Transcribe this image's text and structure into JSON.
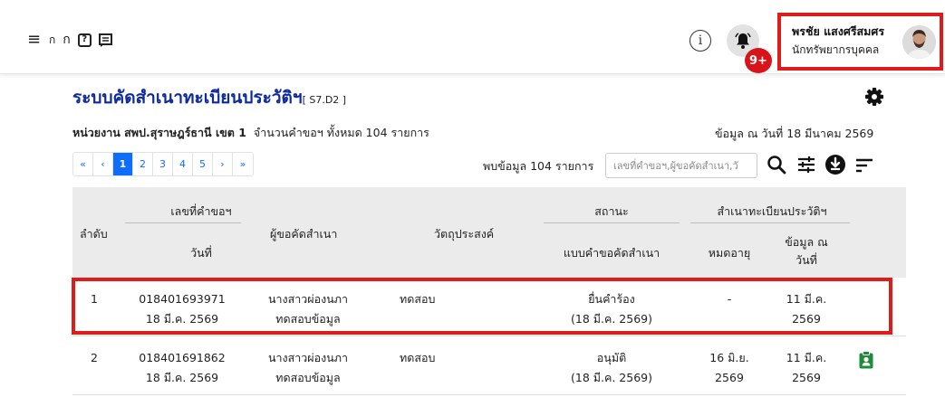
{
  "toolbar": {
    "menu_icon": "hamburger-icon",
    "font_small": "ก",
    "font_large": "ก",
    "help_label": "?",
    "info_label": "i",
    "notification_badge": "9+"
  },
  "user": {
    "name": "พรชัย แสงศรีสมศร",
    "role": "นักทรัพยากรบุคคล"
  },
  "page": {
    "title": "ระบบคัดสำเนาทะเบียนประวัติฯ",
    "code": "[ S7.D2 ]",
    "org_label": "หน่วยงาน สพป.สุราษฎร์ธานี เขต 1",
    "request_count": "จำนวนคำขอฯ ทั้งหมด 104 รายการ",
    "data_date": "ข้อมูล ณ วันที่ 18 มีนาคม 2569",
    "found_text": "พบข้อมูล 104 รายการ",
    "search_placeholder": "เลขที่คำขอฯ,ผู้ขอคัดสำเนา,วั"
  },
  "pagination": [
    "«",
    "‹",
    "1",
    "2",
    "3",
    "4",
    "5",
    "›",
    "»"
  ],
  "table": {
    "headers": {
      "no": "ลำดับ",
      "request_no": "เลขที่คำขอฯ",
      "date": "วันที่",
      "requester": "ผู้ขอคัดสำเนา",
      "purpose": "วัตถุประสงค์",
      "status": "สถานะ",
      "form": "แบบคำขอคัดสำเนา",
      "copy_group": "สำเนาทะเบียนประวัติฯ",
      "expire": "หมดอายุ",
      "data_as_of_1": "ข้อมูล ณ",
      "data_as_of_2": "วันที่"
    },
    "rows": [
      {
        "no": "1",
        "request_no": "018401693971",
        "date": "18 มี.ค. 2569",
        "requester_1": "นางสาวผ่องนภา",
        "requester_2": "ทดสอบข้อมูล",
        "purpose": "ทดสอบ",
        "status": "ยื่นคำร้อง",
        "status_date": "(18 มี.ค. 2569)",
        "expire_1": "-",
        "expire_2": "",
        "asof_1": "11 มี.ค.",
        "asof_2": "2569"
      },
      {
        "no": "2",
        "request_no": "018401691862",
        "date": "18 มี.ค. 2569",
        "requester_1": "นางสาวผ่องนภา",
        "requester_2": "ทดสอบข้อมูล",
        "purpose": "ทดสอบ",
        "status": "อนุมัติ",
        "status_date": "(18 มี.ค. 2569)",
        "expire_1": "16 มิ.ย.",
        "expire_2": "2569",
        "asof_1": "11 มี.ค.",
        "asof_2": "2569"
      }
    ]
  },
  "colors": {
    "title": "#0d2a9e",
    "highlight": "#e01b1b",
    "badge": "#d9131a",
    "pager_active": "#0d6efd",
    "row_icon": "#1f8a3a"
  }
}
